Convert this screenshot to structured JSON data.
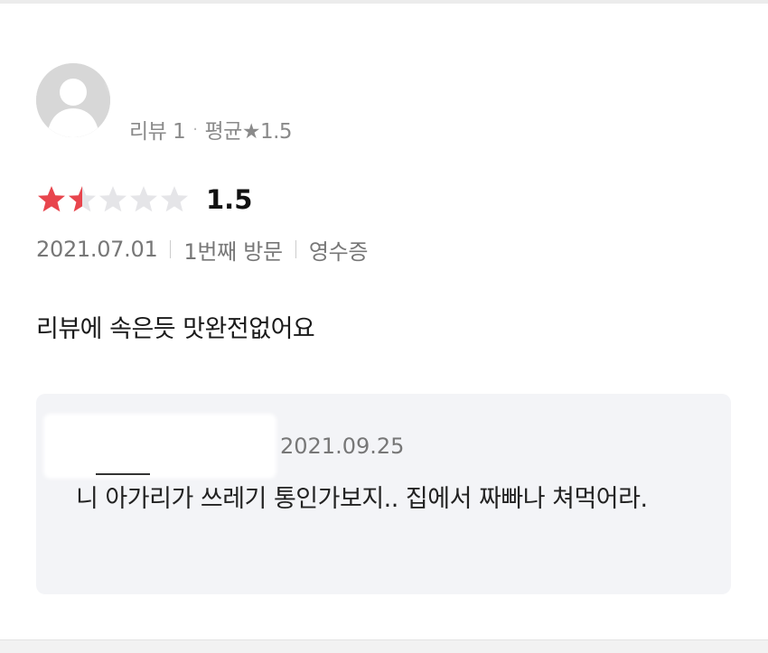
{
  "review": {
    "user_stats": {
      "review_count": "리뷰 1",
      "separator": "·",
      "average": "평균★1.5"
    },
    "rating": {
      "value": 1.5,
      "max": 5,
      "display": "1.5",
      "filled_color": "#e8454d",
      "empty_color": "#e5e5e8"
    },
    "meta": {
      "date": "2021.07.01",
      "visit": "1번째 방문",
      "receipt": "영수증"
    },
    "text": "리뷰에 속은듯 맛완전없어요"
  },
  "owner_reply": {
    "date": "2021.09.25",
    "text": "니 아가리가 쓰레기 통인가보지.. 집에서 짜빠나 쳐먹어라.",
    "background": "#f3f4f7"
  }
}
